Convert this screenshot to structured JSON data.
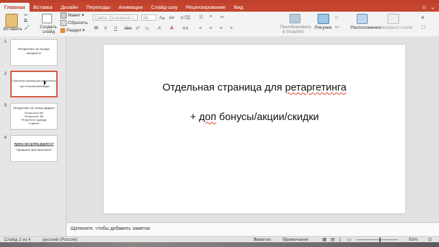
{
  "tabs": [
    "Главная",
    "Вставка",
    "Дизайн",
    "Переходы",
    "Анимации",
    "Слайд-шоу",
    "Рецензирование",
    "Вид"
  ],
  "ribbon": {
    "paste": "Вставить",
    "create_slide": "Создать",
    "create_slide2": "слайд",
    "layout": "Макет",
    "reset": "Сбросить",
    "section": "Раздел",
    "font_name": "Calibri (Основной т...",
    "font_size": "66",
    "convert": "Преобразовать",
    "convert2": "в SmartArt",
    "picture": "Рисунок",
    "arrange": "Расположение",
    "quick_styles": "Экспресс-стили"
  },
  "slides": [
    {
      "num": "1",
      "lines": [
        "Ретаргетинг на полную",
        "мощность!"
      ]
    },
    {
      "num": "2",
      "lines": [
        "Отдельная страница для ретаргетинга",
        "+ доп бонусы/акции/скидки"
      ]
    },
    {
      "num": "3",
      "lines": [
        "Ретаргетинг не только Директ!",
        "Ретаргетинг ВК",
        "Ретаргетинг ФБ",
        "Ретаргетинг Адвордс",
        "И другие"
      ]
    },
    {
      "num": "4",
      "lines": [
        "Нужна настройка Директа?",
        "Напишите мне вконтакте!"
      ]
    }
  ],
  "main_slide": {
    "line1_pre": "Отдельная страница для ",
    "line1_word": "ретаргетинга",
    "line2_pre": "+ ",
    "line2_word": "доп",
    "line2_post": " бонусы/акции/скидки"
  },
  "notes_placeholder": "Щелкните, чтобы добавить заметки",
  "status": {
    "slide": "Слайд 2 из 4",
    "language": "русский (Россия)",
    "notes": "Заметки",
    "comments": "Примечания",
    "zoom": "93%"
  }
}
